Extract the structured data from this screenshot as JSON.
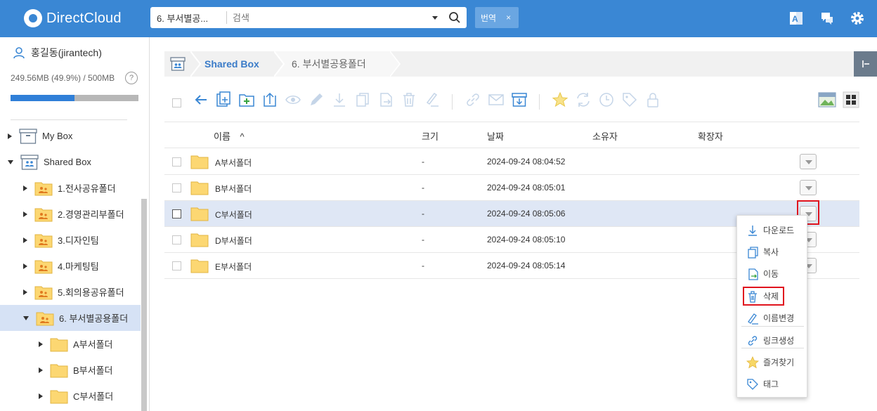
{
  "app": {
    "brand": "DirectCloud",
    "accent": "#3a87d4"
  },
  "search": {
    "folder": "6. 부서별공...",
    "placeholder": "검색"
  },
  "translate": {
    "label": "번역",
    "close": "×"
  },
  "user": {
    "name": "홍길동(jirantech)",
    "usage": "249.56MB (49.9%) / 500MB",
    "usage_fraction": 0.499,
    "help": "?"
  },
  "tree": [
    {
      "label": "My Box",
      "expanded": false,
      "icon": "box-icon"
    },
    {
      "label": "Shared Box",
      "expanded": true,
      "icon": "shared-box-icon"
    },
    {
      "label": "1.전사공유폴더",
      "expanded": false,
      "icon": "shared-folder-icon"
    },
    {
      "label": "2.경영관리부폴더",
      "expanded": false,
      "icon": "shared-folder-icon"
    },
    {
      "label": "3.디자인팀",
      "expanded": false,
      "icon": "shared-folder-icon"
    },
    {
      "label": "4.마케팅팀",
      "expanded": false,
      "icon": "shared-folder-icon"
    },
    {
      "label": "5.회의용공유폴더",
      "expanded": false,
      "icon": "shared-folder-icon"
    },
    {
      "label": "6. 부서별공용폴더",
      "expanded": true,
      "selected": true,
      "icon": "shared-folder-icon"
    },
    {
      "label": "A부서폴더",
      "expanded": false,
      "icon": "folder-icon"
    },
    {
      "label": "B부서폴더",
      "expanded": false,
      "icon": "folder-icon"
    },
    {
      "label": "C부서폴더",
      "expanded": false,
      "icon": "folder-icon"
    }
  ],
  "breadcrumb": {
    "root": "Shared Box",
    "current": "6. 부서별공용폴더"
  },
  "table": {
    "columns": {
      "name": "이름",
      "sort": "^",
      "size": "크기",
      "date": "날짜",
      "owner": "소유자",
      "ext": "확장자"
    },
    "rows": [
      {
        "name": "A부서폴더",
        "size": "-",
        "date": "2024-09-24 08:04:52"
      },
      {
        "name": "B부서폴더",
        "size": "-",
        "date": "2024-09-24 08:05:01"
      },
      {
        "name": "C부서폴더",
        "size": "-",
        "date": "2024-09-24 08:05:06"
      },
      {
        "name": "D부서폴더",
        "size": "-",
        "date": "2024-09-24 08:05:10"
      },
      {
        "name": "E부서폴더",
        "size": "-",
        "date": "2024-09-24 08:05:14"
      }
    ]
  },
  "context_menu": {
    "items": [
      {
        "label": "다운로드",
        "icon": "download-icon"
      },
      {
        "label": "복사",
        "icon": "copy-icon"
      },
      {
        "label": "이동",
        "icon": "move-icon"
      },
      {
        "label": "삭제",
        "icon": "trash-icon"
      },
      {
        "label": "이름변경",
        "icon": "pencil-icon"
      },
      {
        "label": "링크생성",
        "icon": "link-icon"
      },
      {
        "label": "즐겨찾기",
        "icon": "star-icon"
      },
      {
        "label": "태그",
        "icon": "tag-icon"
      }
    ]
  }
}
